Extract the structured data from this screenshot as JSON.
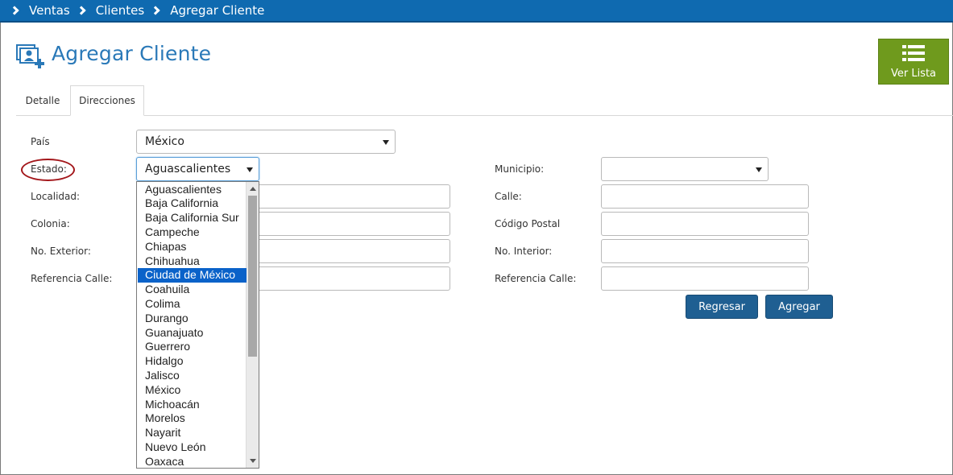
{
  "breadcrumb": [
    "Ventas",
    "Clientes",
    "Agregar Cliente"
  ],
  "page": {
    "title": "Agregar Cliente"
  },
  "ver_lista": {
    "label": "Ver Lista"
  },
  "tabs": {
    "detalle": "Detalle",
    "direcciones": "Direcciones"
  },
  "form": {
    "pais": {
      "label": "País",
      "value": "México"
    },
    "estado": {
      "label": "Estado:",
      "value": "Aguascalientes"
    },
    "municipio": {
      "label": "Municipio:",
      "value": ""
    },
    "localidad": {
      "label": "Localidad:"
    },
    "calle": {
      "label": "Calle:"
    },
    "colonia": {
      "label": "Colonia:"
    },
    "codigo_postal": {
      "label": "Código Postal"
    },
    "no_exterior": {
      "label": "No. Exterior:"
    },
    "no_interior": {
      "label": "No. Interior:"
    },
    "referencia_calle_left": {
      "label": "Referencia Calle:"
    },
    "referencia_calle_right": {
      "label": "Referencia Calle:"
    }
  },
  "buttons": {
    "regresar": "Regresar",
    "agregar": "Agregar"
  },
  "estado_options": [
    "Aguascalientes",
    "Baja California",
    "Baja California Sur",
    "Campeche",
    "Chiapas",
    "Chihuahua",
    "Ciudad de México",
    "Coahuila",
    "Colima",
    "Durango",
    "Guanajuato",
    "Guerrero",
    "Hidalgo",
    "Jalisco",
    "México",
    "Michoacán",
    "Morelos",
    "Nayarit",
    "Nuevo León",
    "Oaxaca"
  ],
  "estado_highlighted": "Ciudad de México",
  "colors": {
    "breadcrumb_bg": "#0f6ab0",
    "title": "#2a79b8",
    "ver_lista_bg": "#6f9a1d",
    "button_bg": "#1f5f92",
    "highlight": "#0a62c9",
    "annotation_circle": "#a3171b"
  },
  "icons": {
    "breadcrumb_separator": "chevron-right-icon",
    "title": "add-client-icon",
    "ver_lista": "list-icon"
  }
}
